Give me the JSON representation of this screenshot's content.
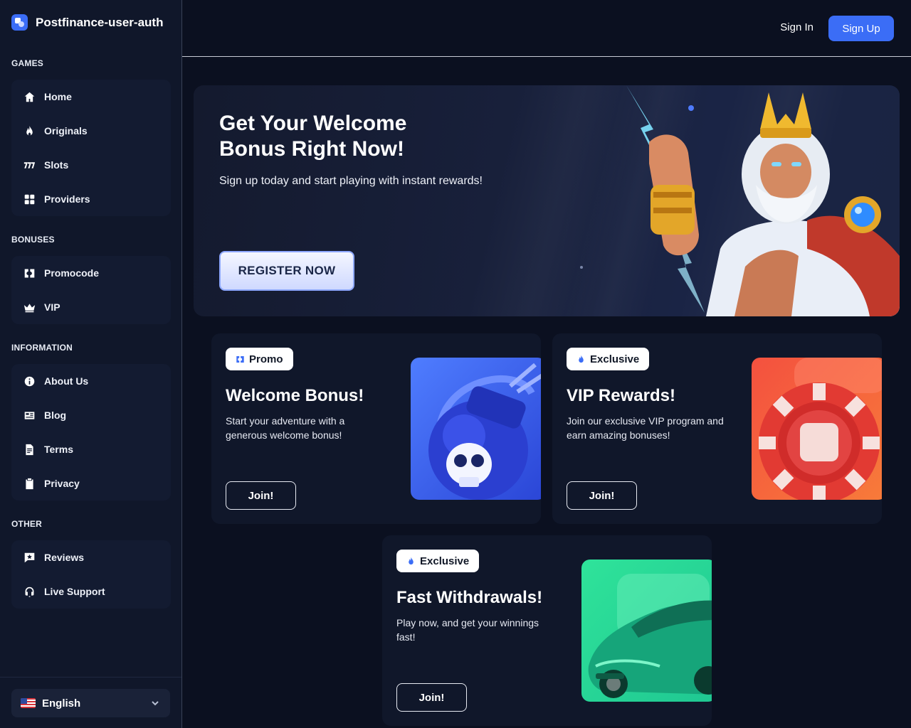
{
  "brand": {
    "name": "Postfinance-user-auth"
  },
  "sidebar": {
    "sections": [
      {
        "title": "GAMES",
        "items": [
          {
            "label": "Home",
            "icon": "home-icon"
          },
          {
            "label": "Originals",
            "icon": "flame-icon"
          },
          {
            "label": "Slots",
            "icon": "slots-777-icon"
          },
          {
            "label": "Providers",
            "icon": "grid-icon"
          }
        ]
      },
      {
        "title": "BONUSES",
        "items": [
          {
            "label": "Promocode",
            "icon": "ticket-icon"
          },
          {
            "label": "VIP",
            "icon": "crown-icon"
          }
        ]
      },
      {
        "title": "INFORMATION",
        "items": [
          {
            "label": "About Us",
            "icon": "info-icon"
          },
          {
            "label": "Blog",
            "icon": "newspaper-icon"
          },
          {
            "label": "Terms",
            "icon": "document-icon"
          },
          {
            "label": "Privacy",
            "icon": "clipboard-check-icon"
          }
        ]
      },
      {
        "title": "OTHER",
        "items": [
          {
            "label": "Reviews",
            "icon": "review-icon"
          },
          {
            "label": "Live Support",
            "icon": "headset-icon"
          }
        ]
      }
    ],
    "language": {
      "label": "English",
      "flag": "us-flag-icon"
    }
  },
  "header": {
    "signin_label": "Sign In",
    "signup_label": "Sign Up"
  },
  "hero": {
    "title": "Get Your Welcome Bonus Right Now!",
    "subtitle": "Sign up today and start playing with instant rewards!",
    "button_label": "REGISTER NOW"
  },
  "cards": [
    {
      "badge": "Promo",
      "badge_icon": "ticket-icon",
      "title": "Welcome Bonus!",
      "desc": "Start your adventure with a generous welcome bonus!",
      "button": "Join!"
    },
    {
      "badge": "Exclusive",
      "badge_icon": "flame-icon",
      "title": "VIP Rewards!",
      "desc": "Join our exclusive VIP program and earn amazing bonuses!",
      "button": "Join!"
    },
    {
      "badge": "Exclusive",
      "badge_icon": "flame-icon",
      "title": "Fast Withdrawals!",
      "desc": "Play now, and get your winnings fast!",
      "button": "Join!"
    }
  ],
  "colors": {
    "accent": "#3b6df6",
    "background": "#0b1020",
    "sidebar": "#10172a",
    "card": "#10172a"
  }
}
